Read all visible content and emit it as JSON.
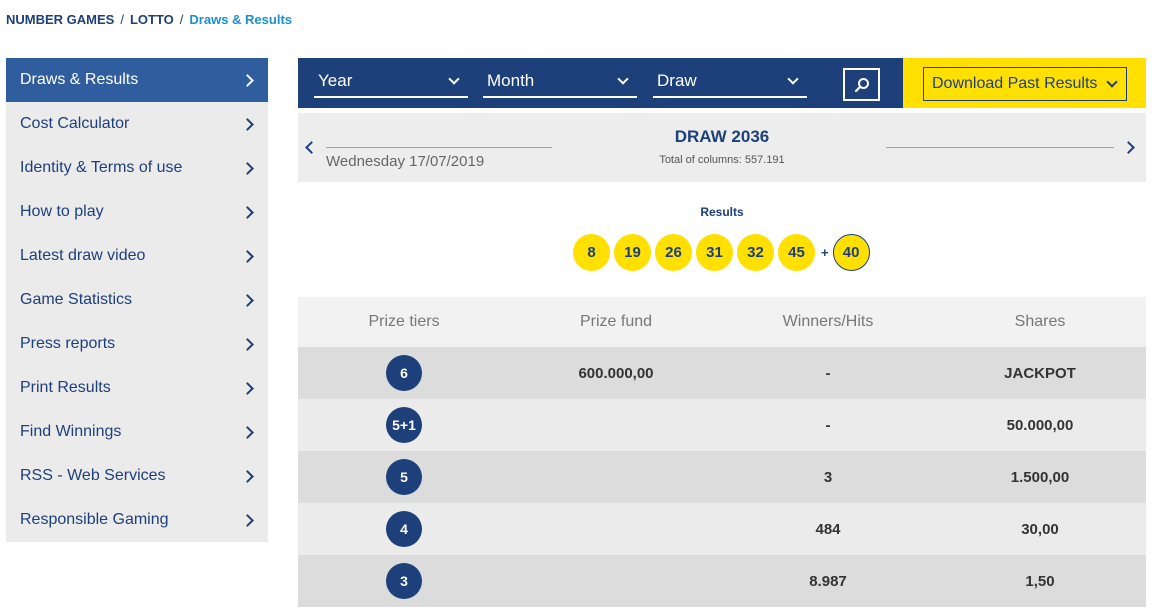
{
  "breadcrumb": [
    "NUMBER GAMES",
    "LOTTO",
    "Draws & Results"
  ],
  "sidebar": {
    "items": [
      {
        "label": "Draws & Results"
      },
      {
        "label": "Cost Calculator"
      },
      {
        "label": "Identity & Terms of use"
      },
      {
        "label": "How to play"
      },
      {
        "label": "Latest draw video"
      },
      {
        "label": "Game Statistics"
      },
      {
        "label": "Press reports"
      },
      {
        "label": "Print Results"
      },
      {
        "label": "Find Winnings"
      },
      {
        "label": "RSS - Web Services"
      },
      {
        "label": "Responsible Gaming"
      }
    ]
  },
  "filters": {
    "year": "Year",
    "month": "Month",
    "draw": "Draw",
    "download": "Download Past Results"
  },
  "draw": {
    "date": "Wednesday 17/07/2019",
    "title": "DRAW 2036",
    "columns": "Total of columns: 557.191"
  },
  "results": {
    "label": "Results",
    "numbers": [
      "8",
      "19",
      "26",
      "31",
      "32",
      "45"
    ],
    "plus": "+",
    "bonus": "40"
  },
  "table": {
    "headers": [
      "Prize tiers",
      "Prize fund",
      "Winners/Hits",
      "Shares"
    ],
    "rows": [
      {
        "tier": "6",
        "fund": "600.000,00",
        "winners": "-",
        "shares": "JACKPOT"
      },
      {
        "tier": "5+1",
        "fund": "",
        "winners": "-",
        "shares": "50.000,00"
      },
      {
        "tier": "5",
        "fund": "",
        "winners": "3",
        "shares": "1.500,00"
      },
      {
        "tier": "4",
        "fund": "",
        "winners": "484",
        "shares": "30,00"
      },
      {
        "tier": "3",
        "fund": "",
        "winners": "8.987",
        "shares": "1,50"
      }
    ]
  },
  "colors": {
    "navy": "#1d3f7a",
    "yellow": "#ffe000",
    "active": "#2f5d9d",
    "link": "#1a8fd0"
  }
}
